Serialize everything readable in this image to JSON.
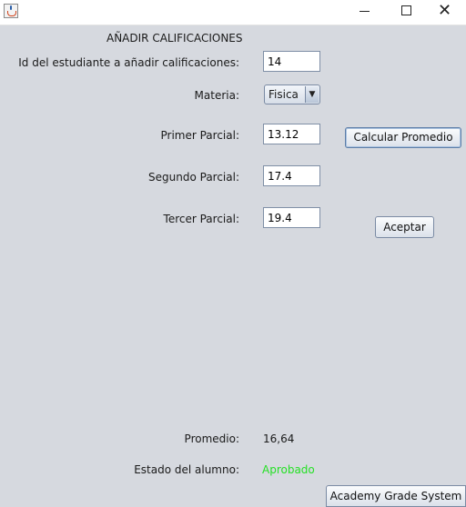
{
  "window": {
    "minimize_glyph": "",
    "maximize_glyph": "",
    "close_glyph": "✕",
    "icon": "java-cup-icon"
  },
  "form": {
    "heading": "AÑADIR CALIFICACIONES",
    "student_id_label": "Id del estudiante a añadir calificaciones:",
    "student_id_value": "14",
    "subject_label": "Materia:",
    "subject_value": "Fisica",
    "first_label": "Primer Parcial:",
    "first_value": "13.12",
    "second_label": "Segundo Parcial:",
    "second_value": "17.4",
    "third_label": "Tercer Parcial:",
    "third_value": "19.4"
  },
  "actions": {
    "calculate_label": "Calcular Promedio",
    "accept_label": "Aceptar",
    "academy_label": "Academy Grade System"
  },
  "results": {
    "average_label": "Promedio:",
    "average_value": "16,64",
    "status_label": "Estado del alumno:",
    "status_value": "Aprobado",
    "status_color": "#25e025"
  }
}
